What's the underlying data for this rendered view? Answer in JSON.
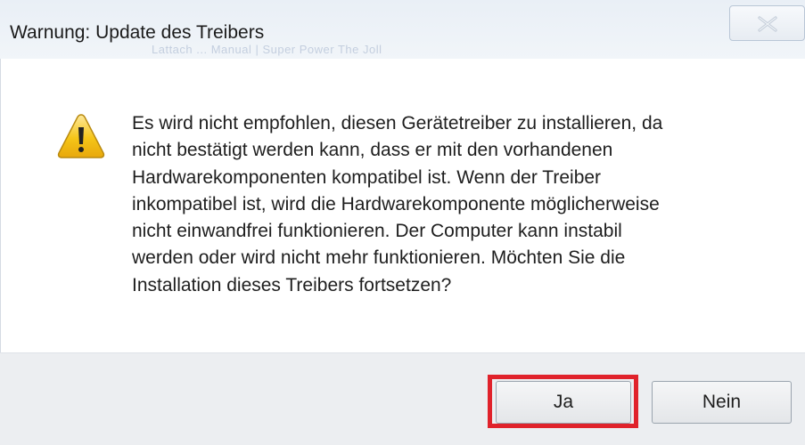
{
  "window": {
    "title": "Warnung: Update des Treibers",
    "background_text": "Lattach  ... Manual  |  Super Power  The Joll"
  },
  "message": {
    "lines": [
      "Es wird nicht empfohlen, diesen Gerätetreiber zu installieren, da",
      "nicht bestätigt werden kann, dass er mit den vorhandenen",
      "Hardwarekomponenten kompatibel ist.  Wenn der Treiber",
      "inkompatibel ist, wird die Hardwarekomponente möglicherweise",
      "nicht einwandfrei funktionieren. Der Computer kann instabil",
      "werden oder wird nicht mehr funktionieren.  Möchten Sie die",
      "Installation dieses Treibers fortsetzen?"
    ]
  },
  "buttons": {
    "yes_label": "Ja",
    "no_label": "Nein"
  },
  "icons": {
    "warning": "warning-icon",
    "close": "close-icon"
  },
  "colors": {
    "highlight": "#e0222b",
    "warning_fill": "#f5c518"
  }
}
